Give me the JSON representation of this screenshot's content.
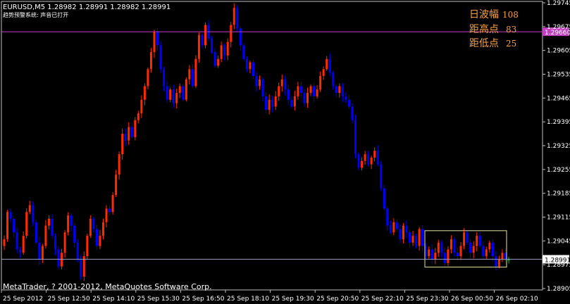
{
  "header": {
    "symbol_line": "EURUSD,M5  1.28982 1.28991 1.28982 1.28991",
    "indicator_line": "趋势预警系统: 声音已打开"
  },
  "stats": [
    {
      "label": "日波幅",
      "value": "108"
    },
    {
      "label": "距高点",
      "value": "83"
    },
    {
      "label": "距低点",
      "value": "25"
    }
  ],
  "copyright": "MetaTrader, ? 2001-2012, MetaQuotes Software Corp.",
  "colors": {
    "background": "#000000",
    "bull": "#ff2a00",
    "bear": "#0000ff",
    "doji": "#00cc00",
    "axis": "#bfbfbf",
    "high_line": "#c040c0",
    "current_line": "#9aa0c8",
    "box": "#e8e0a0",
    "stats_text": "#ffa040"
  },
  "chart_data": {
    "type": "candlestick",
    "x_labels": [
      "25 Sep 2012",
      "25 Sep 12:50",
      "25 Sep 14:10",
      "25 Sep 15:30",
      "25 Sep 16:50",
      "25 Sep 18:10",
      "25 Sep 19:30",
      "25 Sep 20:50",
      "25 Sep 22:10",
      "25 Sep 23:30",
      "26 Sep 00:50",
      "26 Sep 02:10"
    ],
    "y_ticks": [
      "1.29745",
      "1.29675",
      "1.29605",
      "1.29535",
      "1.29465",
      "1.29395",
      "1.29325",
      "1.29255",
      "1.29185",
      "1.29115",
      "1.29045",
      "1.28975",
      "1.28905"
    ],
    "ylim": [
      1.28905,
      1.29745
    ],
    "high_line_label": "1.29660",
    "high_line_value": 1.2966,
    "current_price_label": "1.28991",
    "current_price": 1.28991,
    "range_box": {
      "high": 1.29075,
      "low": 1.28968
    },
    "closes": [
      1.2905,
      1.2913,
      1.2911,
      1.2907,
      1.2902,
      1.2901,
      1.2906,
      1.2913,
      1.2915,
      1.291,
      1.2904,
      1.2899,
      1.2903,
      1.2909,
      1.2911,
      1.2906,
      1.2902,
      1.2897,
      1.2901,
      1.2907,
      1.2912,
      1.2909,
      1.2904,
      1.2899,
      1.2894,
      1.29,
      1.2906,
      1.2911,
      1.2908,
      1.2903,
      1.2906,
      1.291,
      1.2914,
      1.2913,
      1.2918,
      1.2924,
      1.293,
      1.2936,
      1.2934,
      1.2938,
      1.2935,
      1.294,
      1.2942,
      1.2946,
      1.295,
      1.2955,
      1.296,
      1.2966,
      1.2962,
      1.2955,
      1.295,
      1.2946,
      1.2949,
      1.2945,
      1.2948,
      1.295,
      1.2946,
      1.2952,
      1.2955,
      1.295,
      1.2958,
      1.2965,
      1.2962,
      1.2968,
      1.2964,
      1.296,
      1.2956,
      1.2958,
      1.2962,
      1.2959,
      1.2963,
      1.2968,
      1.2973,
      1.2967,
      1.2962,
      1.2958,
      1.2955,
      1.2957,
      1.2953,
      1.295,
      1.2952,
      1.2947,
      1.2943,
      1.2946,
      1.2944,
      1.2947,
      1.295,
      1.2952,
      1.2949,
      1.2946,
      1.2944,
      1.2947,
      1.295,
      1.2948,
      1.2945,
      1.2948,
      1.295,
      1.2947,
      1.2949,
      1.2953,
      1.2955,
      1.2958,
      1.2954,
      1.295,
      1.2948,
      1.295,
      1.2947,
      1.2946,
      1.2944,
      1.294,
      1.293,
      1.2926,
      1.2928,
      1.293,
      1.2927,
      1.2929,
      1.2931,
      1.2927,
      1.292,
      1.2914,
      1.2909,
      1.2907,
      1.291,
      1.2908,
      1.2905,
      1.2909,
      1.2907,
      1.2904,
      1.2906,
      1.2903,
      1.2908,
      1.2903,
      1.29,
      1.2902,
      1.2899,
      1.2901,
      1.2904,
      1.2901,
      1.2898,
      1.2902,
      1.2905,
      1.2901,
      1.29,
      1.2903,
      1.2907,
      1.2904,
      1.2901,
      1.2903,
      1.2906,
      1.2903,
      1.29,
      1.2902,
      1.2904,
      1.29,
      1.2897,
      1.2899,
      1.2901,
      1.2899,
      1.2899
    ]
  }
}
